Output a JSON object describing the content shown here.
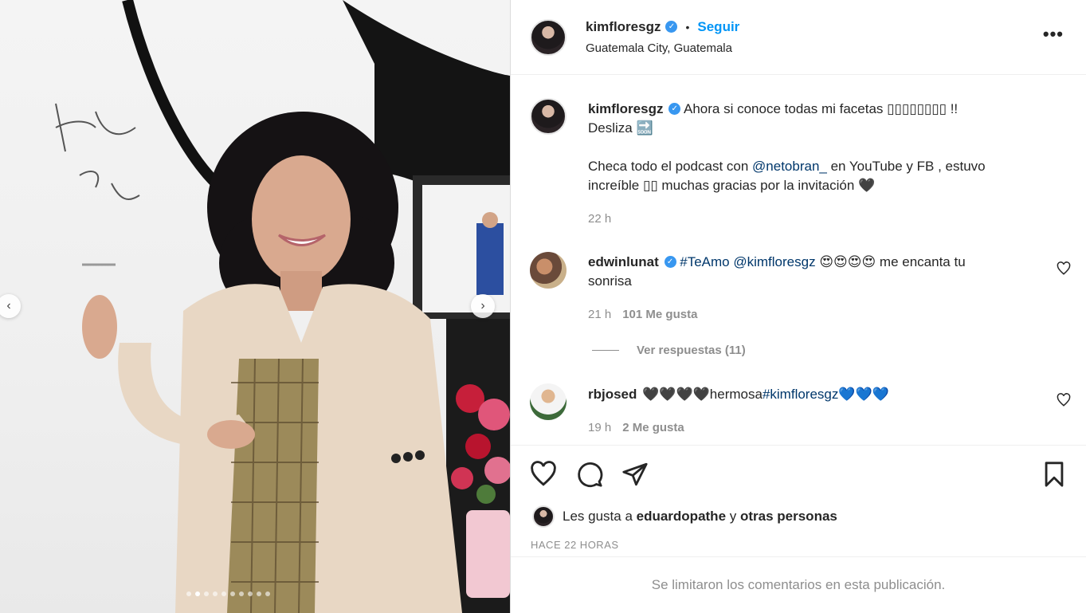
{
  "post": {
    "author": "kimfloresgz",
    "follow_label": "Seguir",
    "separator": "•",
    "location": "Guatemala City, Guatemala",
    "more_label": "•••"
  },
  "caption": {
    "author": "kimfloresgz",
    "line1": "Ahora si conoce todas mi facetas ▯▯▯▯▯▯▯▯ !!",
    "line2": "Desliza 🔜",
    "line3_pre": "Checa todo el podcast con ",
    "mention": "@netobran_",
    "line3_post": " en YouTube y FB , estuvo",
    "line4": "increíble ▯▯ muchas gracias por la invitación 🖤",
    "time": "22 h"
  },
  "comments": [
    {
      "author": "edwinlunat",
      "hashtag": "#TeAmo",
      "mention": "@kimfloresgz",
      "text_after": " 😍😍😍😍 me encanta tu",
      "text_line2": "sonrisa",
      "time": "21 h",
      "likes": "101 Me gusta",
      "replies": "Ver respuestas (11)"
    },
    {
      "author": "rbjosed",
      "text_pre": "🖤🖤🖤🖤hermosa",
      "hashtag": "#kimfloresgz",
      "text_post": "💙💙💙",
      "time": "19 h",
      "likes": "2 Me gusta"
    }
  ],
  "likes_summary": {
    "prefix": "Les gusta a ",
    "user": "eduardopathe",
    "middle": " y ",
    "others": "otras personas"
  },
  "time_ago": "HACE 22 HORAS",
  "comments_limited": "Se limitaron los comentarios en esta publicación.",
  "carousel": {
    "slides": 10,
    "active_index": 1,
    "prev_glyph": "‹",
    "next_glyph": "›"
  },
  "colors": {
    "link": "#0095f6",
    "mention": "#00376b",
    "muted": "#8e8e8e",
    "verified": "#3897f0"
  }
}
